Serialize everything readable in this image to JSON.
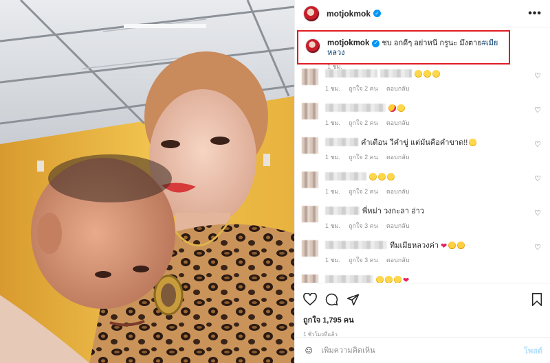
{
  "post": {
    "username": "motjokmok",
    "verified": true,
    "more_label": "•••"
  },
  "caption": {
    "username": "motjokmok",
    "text": "ชบ อกดีๆ อย่าหนี กรูนะ มึงตาย",
    "hashtag": "#เมียหลวง",
    "time": "1 ชม."
  },
  "comments": [
    {
      "text": "",
      "emojis": [
        "laugh",
        "laugh",
        "laugh"
      ],
      "time": "1 ชม.",
      "likes": "ถูกใจ 2 คน",
      "reply": "ตอบกลับ"
    },
    {
      "text": "",
      "emojis": [
        "hearteyes",
        "laugh"
      ],
      "time": "1 ชม.",
      "likes": "ถูกใจ 2 คน",
      "reply": "ตอบกลับ"
    },
    {
      "text": "คำเตือน วีคำขู่ แต่มันคือคำขาด!!",
      "emojis": [
        "laugh"
      ],
      "time": "1 ชม.",
      "likes": "ถูกใจ 2 คน",
      "reply": "ตอบกลับ"
    },
    {
      "text": "",
      "emojis": [
        "laugh",
        "laugh",
        "laugh"
      ],
      "time": "1 ชม.",
      "likes": "ถูกใจ 2 คน",
      "reply": "ตอบกลับ"
    },
    {
      "text": "พี่หม่า วงกะลา อ่าว",
      "emojis": [],
      "time": "1 ชม.",
      "likes": "ถูกใจ 3 คน",
      "reply": "ตอบกลับ"
    },
    {
      "text": "ทีมเมียหลวงค่า",
      "emojis": [
        "heart",
        "scream",
        "scream"
      ],
      "time": "1 ชม.",
      "likes": "ถูกใจ 3 คน",
      "reply": "ตอบกลับ"
    },
    {
      "text": "",
      "emojis": [
        "laugh",
        "laugh",
        "laugh",
        "heart"
      ],
      "time": "",
      "likes": "",
      "reply": ""
    }
  ],
  "actions": {
    "likes_text": "ถูกใจ 1,795 คน",
    "time_ago": "1 ชั่วโมงที่แล้ว"
  },
  "add_comment": {
    "placeholder": "เพิ่มความคิดเห็น",
    "post_label": "โพสต์"
  },
  "colors": {
    "highlight_border": "#e11b22",
    "verified": "#0095f6",
    "hashtag": "#00376b",
    "muted": "#8e8e8e"
  }
}
